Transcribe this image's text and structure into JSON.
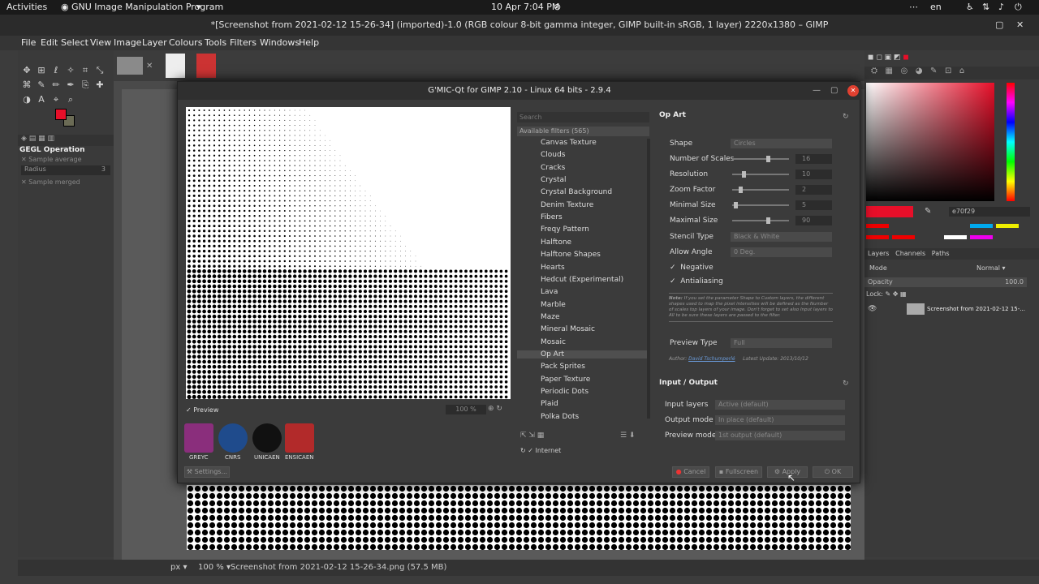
{
  "system_bar": {
    "activities": "Activities",
    "app_menu": "GNU Image Manipulation Program",
    "clock": "10 Apr  7:04 PM",
    "lang": "en"
  },
  "window": {
    "title": "*[Screenshot from 2021-02-12 15-26-34] (imported)-1.0 (RGB colour 8-bit gamma integer, GIMP built-in sRGB, 1 layer) 2220x1380 – GIMP"
  },
  "menu": [
    "File",
    "Edit",
    "Select",
    "View",
    "Image",
    "Layer",
    "Colours",
    "Tools",
    "Filters",
    "Windows",
    "Help"
  ],
  "tool_options": {
    "title": "GEGL Operation",
    "sample_average": "Sample average",
    "radius_label": "Radius",
    "radius_value": "3",
    "sample_merged": "Sample merged"
  },
  "gmic": {
    "title": "G'MIC-Qt for GIMP 2.10 - Linux 64 bits - 2.9.4",
    "preview_label": "Preview",
    "zoom": "100 %",
    "search_placeholder": "Search",
    "filters_header": "Available filters (565)",
    "filters": [
      "Canvas Texture",
      "Clouds",
      "Cracks",
      "Crystal",
      "Crystal Background",
      "Denim Texture",
      "Fibers",
      "Freqy Pattern",
      "Halftone",
      "Halftone Shapes",
      "Hearts",
      "Hedcut (Experimental)",
      "Lava",
      "Marble",
      "Maze",
      "Mineral Mosaic",
      "Mosaic",
      "Op Art",
      "Pack Sprites",
      "Paper Texture",
      "Periodic Dots",
      "Plaid",
      "Polka Dots"
    ],
    "selected_filter": "Op Art",
    "internet_label": "Internet",
    "filter_title": "Op Art",
    "params": {
      "shape_label": "Shape",
      "shape_value": "Circles",
      "num_scales_label": "Number of Scales",
      "num_scales_value": "16",
      "resolution_label": "Resolution",
      "resolution_value": "10",
      "zoom_label": "Zoom Factor",
      "zoom_value": "2",
      "min_size_label": "Minimal Size",
      "min_size_value": "5",
      "max_size_label": "Maximal Size",
      "max_size_value": "90",
      "stencil_label": "Stencil Type",
      "stencil_value": "Black & White",
      "angle_label": "Allow Angle",
      "angle_value": "0 Deg.",
      "negative_label": "Negative",
      "antialias_label": "Antialiasing",
      "note_bold": "Note:",
      "note_text": "If you set the parameter Shape to Custom layers, the different shapes used to map the pixel intensities will be defined as the Number of scales top layers of your image. Don't forget to set also Input layers to All to be sure these layers are passed to the filter.",
      "preview_type_label": "Preview Type",
      "preview_type_value": "Full",
      "author_label": "Author:",
      "author_name": "David Tschumperlé",
      "latest_update": "Latest Update: 2013/10/12"
    },
    "io_title": "Input / Output",
    "input_layers_label": "Input layers",
    "input_layers_value": "Active (default)",
    "output_mode_label": "Output mode",
    "output_mode_value": "In place (default)",
    "preview_mode_label": "Preview mode",
    "preview_mode_value": "1st output (default)",
    "logos": [
      {
        "label": "GREYC",
        "color": "#8a2e7c"
      },
      {
        "label": "CNRS",
        "color": "#1f4b8c"
      },
      {
        "label": "UNICAEN",
        "color": "#111111"
      },
      {
        "label": "ENSICAEN",
        "color": "#b22a2a"
      }
    ],
    "buttons": {
      "settings": "Settings...",
      "cancel": "Cancel",
      "fullscreen": "Fullscreen",
      "apply": "Apply",
      "ok": "OK"
    }
  },
  "right_dock": {
    "hex_value": "e70f29",
    "tabs": [
      "Layers",
      "Channels",
      "Paths"
    ],
    "mode_label": "Mode",
    "mode_value": "Normal",
    "opacity_label": "Opacity",
    "opacity_value": "100.0",
    "lock_label": "Lock:",
    "layer_name": "Screenshot from 2021-02-12 15-...",
    "fg_color": "#e70f29"
  },
  "status": {
    "unit": "px",
    "zoom": "100 %",
    "info": "Screenshot from 2021-02-12 15-26-34.png (57.5 MB)"
  }
}
